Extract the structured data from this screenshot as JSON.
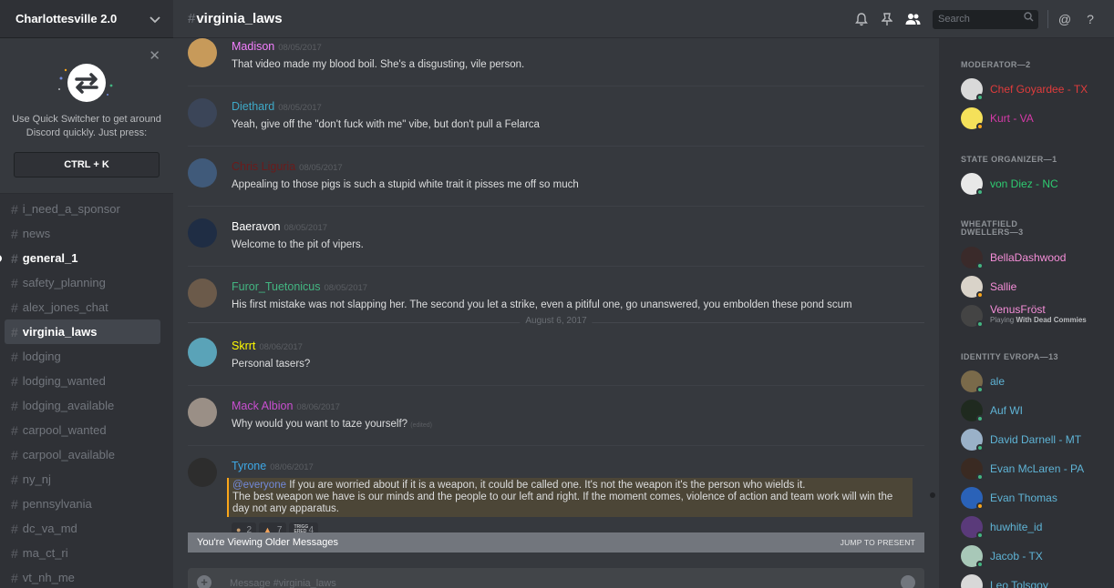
{
  "server": {
    "name": "Charlottesville 2.0"
  },
  "quick_switcher": {
    "text": "Use Quick Switcher to get around Discord quickly. Just press:",
    "shortcut": "CTRL + K"
  },
  "channels": [
    {
      "name": "i_need_a_sponsor",
      "state": "normal"
    },
    {
      "name": "news",
      "state": "normal"
    },
    {
      "name": "general_1",
      "state": "unread"
    },
    {
      "name": "safety_planning",
      "state": "normal"
    },
    {
      "name": "alex_jones_chat",
      "state": "normal"
    },
    {
      "name": "virginia_laws",
      "state": "active"
    },
    {
      "name": "lodging",
      "state": "normal"
    },
    {
      "name": "lodging_wanted",
      "state": "normal"
    },
    {
      "name": "lodging_available",
      "state": "normal"
    },
    {
      "name": "carpool_wanted",
      "state": "normal"
    },
    {
      "name": "carpool_available",
      "state": "normal"
    },
    {
      "name": "ny_nj",
      "state": "normal"
    },
    {
      "name": "pennsylvania",
      "state": "normal"
    },
    {
      "name": "dc_va_md",
      "state": "normal"
    },
    {
      "name": "ma_ct_ri",
      "state": "normal"
    },
    {
      "name": "vt_nh_me",
      "state": "normal"
    }
  ],
  "header": {
    "channel": "virginia_laws",
    "search_placeholder": "Search"
  },
  "messages": [
    {
      "author": "Madison",
      "color": "#f47fff",
      "timestamp": "08/05/2017",
      "text": "That video made my blood boil. She's a disgusting, vile person.",
      "avatar": "#c79a5a"
    },
    {
      "author": "Diethard",
      "color": "#3ea8c6",
      "timestamp": "08/05/2017",
      "text": "Yeah, give off the \"don't fuck with me\" vibe, but don't pull a Felarca",
      "avatar": "#3b4558"
    },
    {
      "author": "Chris Liguria",
      "color": "#6b1b1b",
      "timestamp": "08/05/2017",
      "text": "Appealing to those pigs is such a stupid white trait it pisses me off so much",
      "avatar": "#405a7a"
    },
    {
      "author": "Baeravon",
      "color": "#ffffff",
      "timestamp": "08/05/2017",
      "text": "Welcome to the pit of vipers.",
      "avatar": "#1f2d44"
    },
    {
      "author": "Furor_Tuetonicus",
      "color": "#43b581",
      "timestamp": "08/05/2017",
      "text": "His first mistake was not slapping her. The second you let a strike, even a pitiful one, go unanswered, you embolden these pond scum",
      "avatar": "#6b5a4a"
    },
    {
      "author": "Skrrt",
      "color": "#fffb00",
      "timestamp": "08/06/2017",
      "text": "Personal tasers?",
      "avatar": "#5aa3b8"
    },
    {
      "author": "Mack Albion",
      "color": "#c94fd0",
      "timestamp": "08/06/2017",
      "text": "Why would you want to taze yourself?",
      "edited": "(edited)",
      "avatar": "#9a8f86"
    },
    {
      "author": "Tyrone",
      "color": "#3ea8e6",
      "timestamp": "08/06/2017",
      "mention": "@everyone",
      "text": "If you are worried about if it is a weapon, it could be called one. It's not the weapon it's the person who wields it.",
      "text2": "The best weapon we have is our minds and the people to our left and right. If the moment comes, violence of action and team work will win the day not any apparatus.",
      "avatar": "#2d2d2d"
    }
  ],
  "date_divider": "August 6, 2017",
  "reactions": [
    {
      "count": "2",
      "icon": "person-emoji"
    },
    {
      "count": "7",
      "icon": "party-emoji"
    },
    {
      "count": "4",
      "icon": "sticker-emoji",
      "label": "TRIGG ERED"
    }
  ],
  "older_bar": {
    "label": "You're Viewing Older Messages",
    "action": "JUMP TO PRESENT"
  },
  "composer": {
    "placeholder": "Message #virginia_laws"
  },
  "member_groups": [
    {
      "title": "MODERATOR—2",
      "members": [
        {
          "name": "Chef Goyardee - TX",
          "color": "#e03c3c",
          "status": "#43b581",
          "avatar": "#d9d9d9"
        },
        {
          "name": "Kurt - VA",
          "color": "#d63aa8",
          "status": "#faa61a",
          "avatar": "#f5e15a"
        }
      ]
    },
    {
      "title": "STATE ORGANIZER—1",
      "members": [
        {
          "name": "von Diez - NC",
          "color": "#2ecc71",
          "status": "#43b581",
          "avatar": "#e8e8e8"
        }
      ]
    },
    {
      "title": "WHEATFIELD DWELLERS—3",
      "members": [
        {
          "name": "BellaDashwood",
          "color": "#f58ed8",
          "status": "#43b581",
          "avatar": "#3a2a2a"
        },
        {
          "name": "Sallie",
          "color": "#f58ed8",
          "status": "#faa61a",
          "avatar": "#d9d3c9"
        },
        {
          "name": "VenusFröst",
          "color": "#f58ed8",
          "status": "#43b581",
          "avatar": "#444444",
          "game_prefix": "Playing",
          "game": "With Dead Commies"
        }
      ]
    },
    {
      "title": "IDENTITY EVROPA—13",
      "members": [
        {
          "name": "ale",
          "color": "#5fb4d6",
          "status": "#43b581",
          "avatar": "#7a6a4a"
        },
        {
          "name": "Auf WI",
          "color": "#5fb4d6",
          "status": "#43b581",
          "avatar": "#1f2a1f"
        },
        {
          "name": "David Darnell - MT",
          "color": "#5fb4d6",
          "status": "#43b581",
          "avatar": "#9ab1c8"
        },
        {
          "name": "Evan McLaren - PA",
          "color": "#5fb4d6",
          "status": "#43b581",
          "avatar": "#3a2a22"
        },
        {
          "name": "Evan Thomas",
          "color": "#5fb4d6",
          "status": "#faa61a",
          "avatar": "#2a62b8"
        },
        {
          "name": "huwhite_id",
          "color": "#5fb4d6",
          "status": "#43b581",
          "avatar": "#5a3a7a"
        },
        {
          "name": "Jacob - TX",
          "color": "#5fb4d6",
          "status": "#43b581",
          "avatar": "#a8c8b8"
        },
        {
          "name": "Leo Tolsgoy",
          "color": "#5fb4d6",
          "status": "#43b581",
          "avatar": "#d8d8d8"
        }
      ]
    }
  ]
}
